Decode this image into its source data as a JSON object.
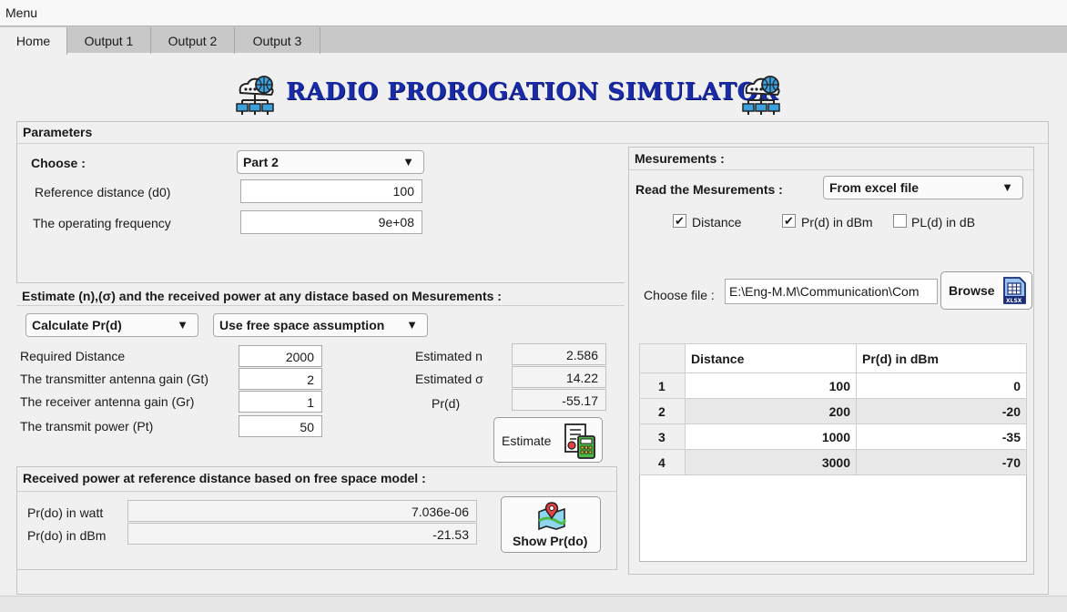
{
  "menu": {
    "label": "Menu"
  },
  "tabs": [
    {
      "label": "Home",
      "active": true
    },
    {
      "label": "Output 1"
    },
    {
      "label": "Output 2"
    },
    {
      "label": "Output 3"
    }
  ],
  "title": "RADIO PROROGATION SIMULATOR",
  "parameters": {
    "title": "Parameters",
    "choose_label": "Choose :",
    "choose_value": "Part 2",
    "ref_distance_label": "Reference distance (d0)",
    "ref_distance_value": "100",
    "frequency_label": "The operating frequency",
    "frequency_value": "9e+08"
  },
  "estimate": {
    "title": "Estimate (n),(σ) and the received power at any distace based on Mesurements :",
    "calc_dropdown": "Calculate Pr(d)",
    "assumption_dropdown": "Use free space assumption",
    "required_distance_label": "Required Distance",
    "required_distance_value": "2000",
    "gt_label": "The transmitter antenna gain (Gt)",
    "gt_value": "2",
    "gr_label": "The receiver antenna gain (Gr)",
    "gr_value": "1",
    "pt_label": "The transmit power (Pt)",
    "pt_value": "50",
    "n_label": "Estimated n",
    "n_value": "2.586",
    "sigma_label": "Estimated σ",
    "sigma_value": "14.22",
    "prd_label": "Pr(d)",
    "prd_value": "-55.17",
    "estimate_button": "Estimate"
  },
  "received": {
    "title": "Received power at reference distance based on free space model :",
    "watt_label": "Pr(do) in watt",
    "watt_value": "7.036e-06",
    "dbm_label": "Pr(do) in dBm",
    "dbm_value": "-21.53",
    "show_button": "Show Pr(do)"
  },
  "measurements": {
    "title": "Mesurements :",
    "read_label": "Read the Mesurements :",
    "read_value": "From excel file",
    "checkboxes": [
      {
        "label": "Distance",
        "checked": true
      },
      {
        "label": "Pr(d) in dBm",
        "checked": true
      },
      {
        "label": "PL(d) in dB",
        "checked": false
      }
    ],
    "file_label": "Choose file :",
    "file_value": "E:\\Eng-M.M\\Communication\\Com",
    "browse_button": "Browse",
    "xlsx_badge": "XLSX",
    "table": {
      "columns": [
        "",
        "Distance",
        "Pr(d) in dBm"
      ],
      "rows": [
        {
          "index": "1",
          "distance": "100",
          "prd": "0"
        },
        {
          "index": "2",
          "distance": "200",
          "prd": "-20"
        },
        {
          "index": "3",
          "distance": "1000",
          "prd": "-35"
        },
        {
          "index": "4",
          "distance": "3000",
          "prd": "-70"
        }
      ]
    }
  },
  "colors": {
    "title": "#1a2ba8",
    "icon_blue": "#3aa0e0",
    "icon_dark": "#222222"
  },
  "icons": [
    "network-globe-icon",
    "estimate-calculator-icon",
    "map-pin-icon",
    "xlsx-file-icon",
    "checkmark-icon",
    "dropdown-arrow-icon"
  ]
}
